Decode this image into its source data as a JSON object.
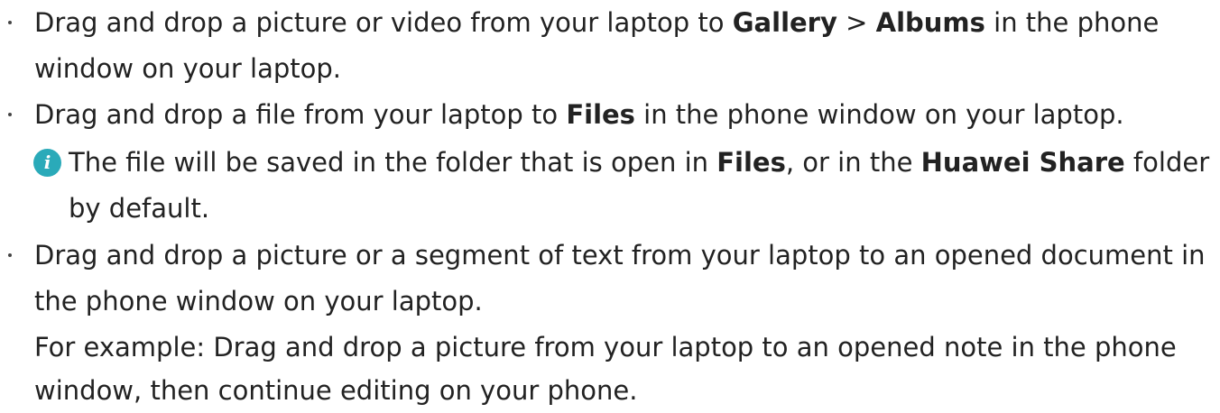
{
  "icons": {
    "bullet": "bullet-dot",
    "note": "info-icon",
    "note_glyph": "i"
  },
  "colors": {
    "text": "#222222",
    "info_icon": "#2aaab9"
  },
  "items": [
    {
      "line1": {
        "pre": "Drag and drop a picture or video from your laptop to ",
        "b1": "Gallery",
        "mid": " > ",
        "b2": "Albums",
        "post": " in the phone"
      },
      "line2": "window on your laptop."
    },
    {
      "line1": {
        "pre": "Drag and drop a file from your laptop to ",
        "b1": "Files",
        "post": " in the phone window on your laptop."
      },
      "note": {
        "line1": {
          "pre": "The file will be saved in the folder that is open in ",
          "b1": "Files",
          "mid": ", or in the ",
          "b2": "Huawei Share",
          "post": " folder"
        },
        "line2": "by default."
      }
    },
    {
      "line1": "Drag and drop a picture or a segment of text from your laptop to an opened document in",
      "line2": "the phone window on your laptop.",
      "example_line1": "For example: Drag and drop a picture from your laptop to an opened note in the phone",
      "example_line2": "window, then continue editing on your phone."
    }
  ]
}
